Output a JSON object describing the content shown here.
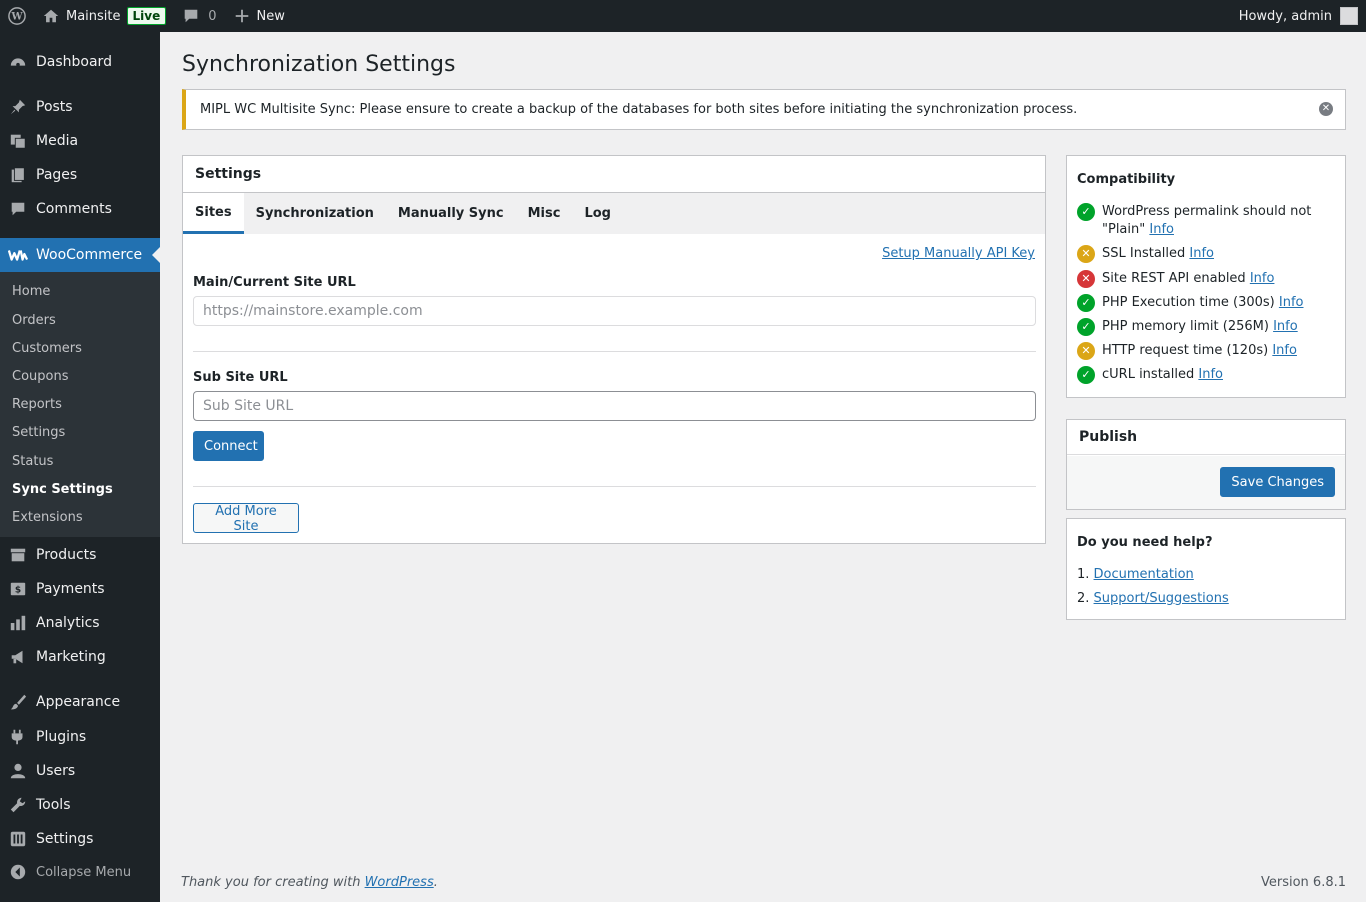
{
  "adminbar": {
    "site_name": "Mainsite",
    "live_badge": "Live",
    "comments_count": "0",
    "new_label": "New",
    "howdy": "Howdy, admin"
  },
  "sidebar": {
    "items": [
      {
        "label": "Dashboard",
        "icon": "dashboard-icon"
      },
      {
        "label": "Posts",
        "icon": "pin-icon"
      },
      {
        "label": "Media",
        "icon": "media-icon"
      },
      {
        "label": "Pages",
        "icon": "pages-icon"
      },
      {
        "label": "Comments",
        "icon": "comment-icon"
      },
      {
        "label": "WooCommerce",
        "icon": "woocommerce-icon"
      },
      {
        "label": "Products",
        "icon": "archive-icon"
      },
      {
        "label": "Payments",
        "icon": "payments-icon"
      },
      {
        "label": "Analytics",
        "icon": "bar-chart-icon"
      },
      {
        "label": "Marketing",
        "icon": "megaphone-icon"
      },
      {
        "label": "Appearance",
        "icon": "brush-icon"
      },
      {
        "label": "Plugins",
        "icon": "plug-icon"
      },
      {
        "label": "Users",
        "icon": "user-icon"
      },
      {
        "label": "Tools",
        "icon": "wrench-icon"
      },
      {
        "label": "Settings",
        "icon": "settings-icon"
      }
    ],
    "submenu": [
      "Home",
      "Orders",
      "Customers",
      "Coupons",
      "Reports",
      "Settings",
      "Status",
      "Sync Settings",
      "Extensions"
    ],
    "collapse_label": "Collapse Menu"
  },
  "page": {
    "title": "Synchronization Settings",
    "notice": "MIPL WC Multisite Sync: Please ensure to create a backup of the databases for both sites before initiating the synchronization process."
  },
  "settings": {
    "header": "Settings",
    "tabs": [
      "Sites",
      "Synchronization",
      "Manually Sync",
      "Misc",
      "Log"
    ],
    "api_link": "Setup Manually API Key",
    "main_label": "Main/Current Site URL",
    "main_placeholder": "https://mainstore.example.com",
    "sub_label": "Sub Site URL",
    "sub_placeholder": "Sub Site URL",
    "connect_label": "Connect",
    "add_more_label": "Add More Site"
  },
  "compatibility": {
    "title": "Compatibility",
    "info_label": "Info",
    "items": [
      {
        "text": "WordPress permalink should not \"Plain\"",
        "status": "ok"
      },
      {
        "text": "SSL Installed",
        "status": "warning"
      },
      {
        "text": "Site REST API enabled",
        "status": "error"
      },
      {
        "text": "PHP Execution time (300s)",
        "status": "ok"
      },
      {
        "text": "PHP memory limit (256M)",
        "status": "ok"
      },
      {
        "text": "HTTP request time (120s)",
        "status": "warning"
      },
      {
        "text": "cURL installed",
        "status": "ok"
      }
    ]
  },
  "publish": {
    "title": "Publish",
    "save_label": "Save Changes"
  },
  "help": {
    "title": "Do you need help?",
    "items": [
      {
        "num": "1.",
        "label": "Documentation"
      },
      {
        "num": "2.",
        "label": "Support/Suggestions"
      }
    ]
  },
  "footer": {
    "thanks_prefix": "Thank you for creating with ",
    "wp_link": "WordPress",
    "thanks_suffix": ".",
    "version": "Version 6.8.1"
  },
  "colors": {
    "admin_dark": "#1d2327",
    "accent": "#2271b1",
    "ok": "#00a32a",
    "warning": "#dba617",
    "error": "#d63638"
  }
}
